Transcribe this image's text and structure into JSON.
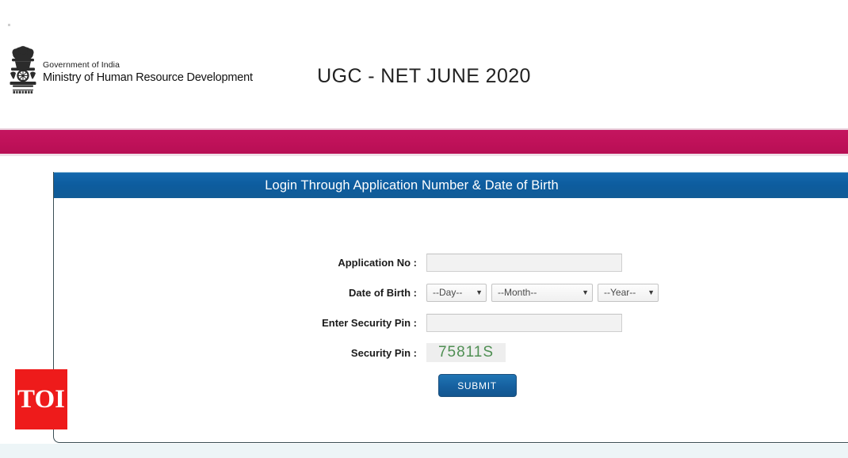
{
  "header": {
    "emblem_alt": "Government of India emblem - Lion Capital of Ashoka",
    "gov_line": "Government of India",
    "ministry_line": "Ministry of Human Resource Development",
    "exam_title": "UGC - NET JUNE 2020"
  },
  "colors": {
    "band": "#c2135c",
    "panel_header": "#0f5fa2",
    "submit": "#16609f",
    "captcha_text": "#4f8f53",
    "toi_red": "#ee1b1b"
  },
  "panel": {
    "title": "Login Through Application Number & Date of Birth"
  },
  "form": {
    "application_no": {
      "label": "Application No :",
      "value": "",
      "placeholder": ""
    },
    "date_of_birth": {
      "label": "Date of Birth :",
      "day": "--Day--",
      "month": "--Month--",
      "year": "--Year--"
    },
    "enter_security_pin": {
      "label": "Enter Security Pin :",
      "value": "",
      "placeholder": ""
    },
    "security_pin": {
      "label": "Security Pin :",
      "value": "75811S"
    },
    "submit_label": "SUBMIT"
  },
  "watermark": {
    "toi_label": "TOI"
  }
}
